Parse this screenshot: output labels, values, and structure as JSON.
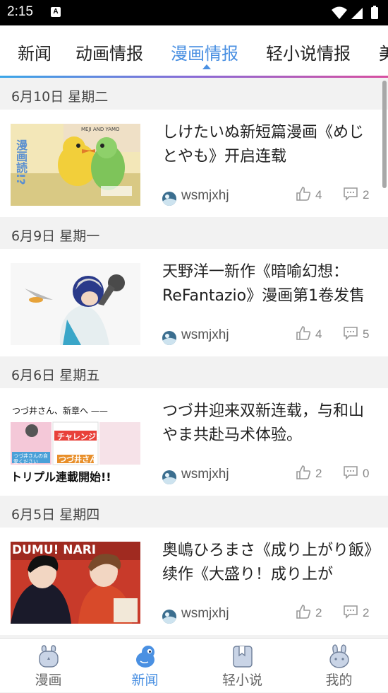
{
  "status_bar": {
    "time": "2:15",
    "notif_letter": "A"
  },
  "tabs": [
    {
      "label": "新闻"
    },
    {
      "label": "动画情报"
    },
    {
      "label": "漫画情报"
    },
    {
      "label": "轻小说情报"
    },
    {
      "label": "美"
    }
  ],
  "active_tab": "漫画情报",
  "feed": [
    {
      "date": "6月10日 星期二",
      "title": "しけたいぬ新短篇漫画《めじとやも》开启连载",
      "author": "wsmjxhj",
      "likes": "4",
      "comments": "2"
    },
    {
      "date": "6月9日 星期一",
      "title": "天野洋一新作《暗喻幻想：ReFantazio》漫画第1卷发售",
      "author": "wsmjxhj",
      "likes": "4",
      "comments": "5"
    },
    {
      "date": "6月6日 星期五",
      "title": "つづ井迎来双新连载，与和山やま共赴马术体验。",
      "author": "wsmjxhj",
      "likes": "2",
      "comments": "0"
    },
    {
      "date": "6月5日 星期四",
      "title": "奥嶋ひろまさ《成り上がり飯》续作《大盛り！成り上が",
      "author": "wsmjxhj",
      "likes": "2",
      "comments": "2"
    }
  ],
  "thumb_texts": {
    "t1_side": "漫画読!?",
    "t1_top": "MEJI AND YAMO",
    "t3_top": "つづ井さん、新章へ ——",
    "t3_banner": "チャレンジ!",
    "t3_cover": "つづ井さん",
    "t3_sub": "つづ井さんの自愛ください",
    "t3_bottom": "トリプル連載開始!!",
    "t4_top": "DUMU! NARI"
  },
  "bottom_nav": [
    {
      "label": "漫画",
      "icon": "bunny-icon"
    },
    {
      "label": "新闻",
      "icon": "bird-icon"
    },
    {
      "label": "轻小说",
      "icon": "book-icon"
    },
    {
      "label": "我的",
      "icon": "rabbit-icon"
    }
  ],
  "colors": {
    "accent": "#4a90e2",
    "gradient_start": "#3aa6e8",
    "gradient_end": "#d84fa0"
  }
}
